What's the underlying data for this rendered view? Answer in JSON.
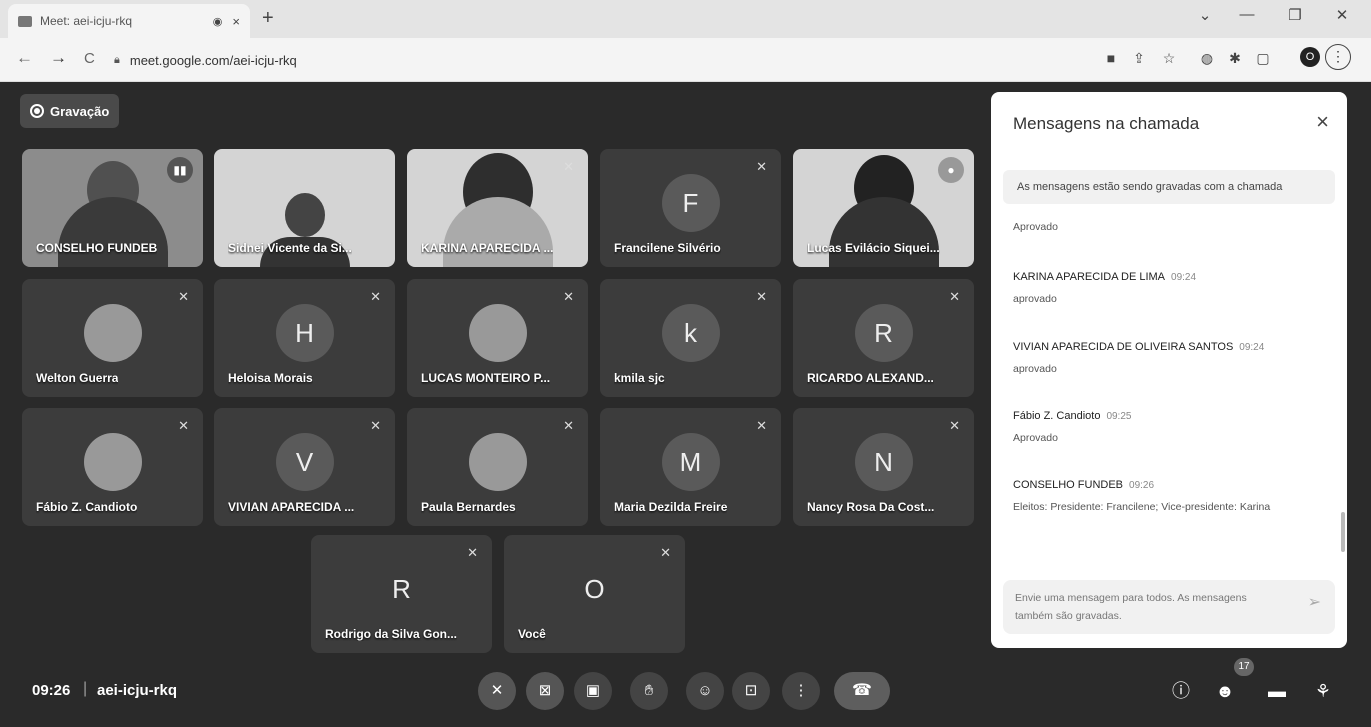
{
  "browser": {
    "tab_title": "Meet: aei-icju-rkq",
    "tab_rec_icon": "recording-dot-icon",
    "close_tab": "×",
    "new_tab": "+",
    "url": "meet.google.com/aei-icju-rkq",
    "win_controls": {
      "dropdown": "⌄",
      "minimize": "—",
      "maximize": "❐",
      "close": "✕"
    },
    "nav": {
      "back": "←",
      "forward": "→",
      "reload": "C"
    },
    "profile_initial": "O",
    "menu": "⋮"
  },
  "meet": {
    "recording_label": "Gravação",
    "clock": "09:26",
    "separator": "|",
    "meeting_code": "aei-icju-rkq",
    "tiles": [
      {
        "name": "CONSELHO FUNDEB",
        "type": "video"
      },
      {
        "name": "Sidnei Vicente da Si...",
        "type": "video"
      },
      {
        "name": "KARINA APARECIDA ...",
        "type": "video"
      },
      {
        "name": "Francilene Silvério",
        "initial": "F"
      },
      {
        "name": "Lucas Evilácio Siquei...",
        "type": "video"
      },
      {
        "name": "Welton Guerra",
        "type": "photo"
      },
      {
        "name": "Heloisa Morais",
        "initial": "H"
      },
      {
        "name": "LUCAS MONTEIRO P...",
        "type": "photo"
      },
      {
        "name": "kmila sjc",
        "initial": "k"
      },
      {
        "name": "RICARDO ALEXAND...",
        "initial": "R"
      },
      {
        "name": "Fábio Z. Candioto",
        "type": "photo"
      },
      {
        "name": "VIVIAN APARECIDA ...",
        "initial": "V"
      },
      {
        "name": "Paula Bernardes",
        "type": "photo"
      },
      {
        "name": "Maria Dezilda Freire",
        "initial": "M"
      },
      {
        "name": "Nancy Rosa Da Cost...",
        "initial": "N"
      },
      {
        "name": "Rodrigo da Silva Gon...",
        "initial": "R"
      },
      {
        "name": "Você",
        "initial": "O"
      }
    ],
    "people_count": "17"
  },
  "chat": {
    "title": "Mensagens na chamada",
    "close": "×",
    "notice": "As mensagens estão sendo gravadas com a chamada",
    "messages": [
      {
        "sender": "",
        "time": "",
        "text": "Aprovado"
      },
      {
        "sender": "KARINA APARECIDA DE LIMA",
        "time": "09:24",
        "text": "aprovado"
      },
      {
        "sender": "VIVIAN APARECIDA DE OLIVEIRA SANTOS",
        "time": "09:24",
        "text": "aprovado"
      },
      {
        "sender": "Fábio Z. Candioto",
        "time": "09:25",
        "text": "Aprovado"
      },
      {
        "sender": "CONSELHO FUNDEB",
        "time": "09:26",
        "text": "Eleitos: Presidente: Francilene; Vice-presidente: Karina"
      }
    ],
    "input_placeholder": "Envie uma mensagem para todos. As mensagens também são gravadas.",
    "send_icon": "send-icon"
  }
}
